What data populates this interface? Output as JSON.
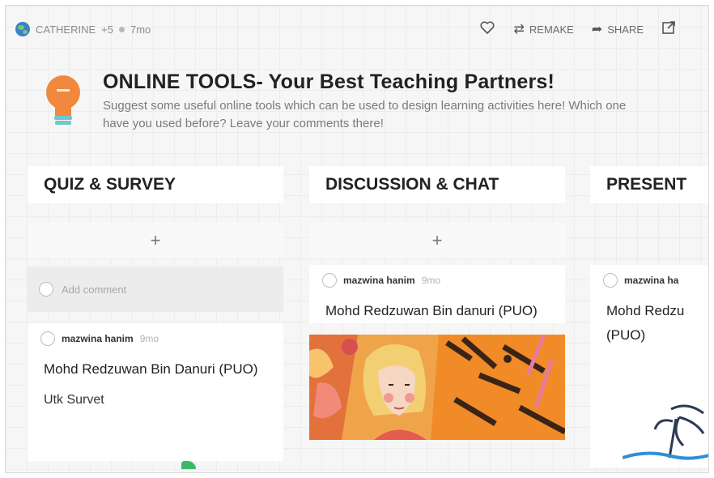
{
  "topbar": {
    "author": "CATHERINE",
    "followers": "+5",
    "age": "7mo",
    "remake_label": "REMAKE",
    "share_label": "SHARE"
  },
  "header": {
    "title": "ONLINE TOOLS- Your Best Teaching Partners!",
    "description": "Suggest some useful online tools which can be used to design learning activities here! Which one have you used before? Leave your comments there!"
  },
  "columns": [
    {
      "title": "QUIZ & SURVEY",
      "add_symbol": "+",
      "add_comment_placeholder": "Add comment",
      "post": {
        "author": "mazwina hanim",
        "age": "9mo",
        "title": "Mohd Redzuwan Bin Danuri (PUO)",
        "body": "Utk Survet"
      }
    },
    {
      "title": "DISCUSSION & CHAT",
      "add_symbol": "+",
      "post": {
        "author": "mazwina hanim",
        "age": "9mo",
        "title": "Mohd Redzuwan Bin danuri (PUO)"
      }
    },
    {
      "title": "PRESENT",
      "post": {
        "author": "mazwina ha",
        "title": "Mohd Redzu (PUO)"
      }
    }
  ],
  "colors": {
    "bulb": "#f0883e",
    "bulb_base": "#6fc7d2",
    "image_orange": "#f0a44a"
  }
}
